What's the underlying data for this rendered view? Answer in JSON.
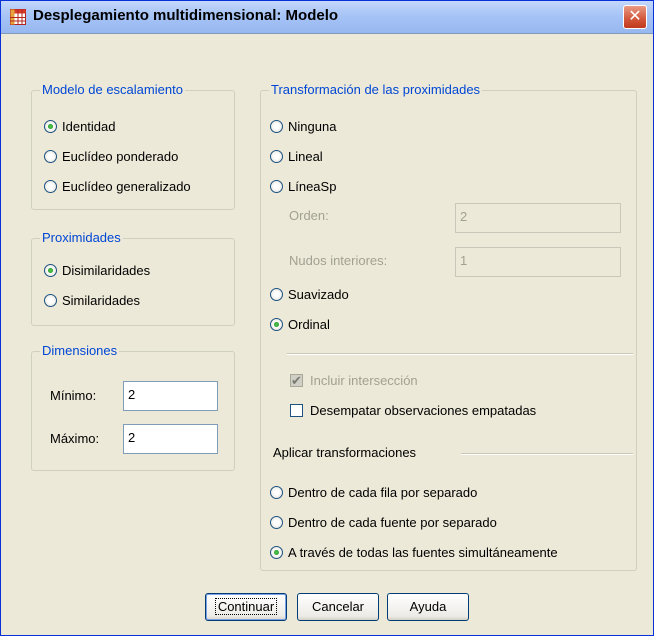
{
  "window": {
    "title": "Desplegamiento multidimensional: Modelo",
    "close_glyph": "✕"
  },
  "modelo": {
    "legend": "Modelo de escalamiento",
    "options": [
      "Identidad",
      "Euclídeo ponderado",
      "Euclídeo generalizado"
    ],
    "selected": "Identidad"
  },
  "proximidades": {
    "legend": "Proximidades",
    "options": [
      "Disimilaridades",
      "Similaridades"
    ],
    "selected": "Disimilaridades"
  },
  "dimensiones": {
    "legend": "Dimensiones",
    "min_label": "Mínimo:",
    "min_value": "2",
    "max_label": "Máximo:",
    "max_value": "2"
  },
  "transformacion": {
    "legend": "Transformación de las proximidades",
    "options": [
      "Ninguna",
      "Lineal",
      "LíneaSp",
      "Suavizado",
      "Ordinal"
    ],
    "selected": "Ordinal",
    "orden_label": "Orden:",
    "orden_value": "2",
    "nudos_label": "Nudos interiores:",
    "nudos_value": "1",
    "incluir_label": "Incluir intersección",
    "desempatar_label": "Desempatar observaciones empatadas",
    "aplicar_label": "Aplicar transformaciones",
    "aplicar_options": [
      "Dentro de cada fila por separado",
      "Dentro de cada fuente por separado",
      "A través de todas las fuentes simultáneamente"
    ],
    "aplicar_selected": "A través de todas las fuentes simultáneamente"
  },
  "buttons": {
    "continuar": "Continuar",
    "cancelar": "Cancelar",
    "ayuda": "Ayuda"
  }
}
